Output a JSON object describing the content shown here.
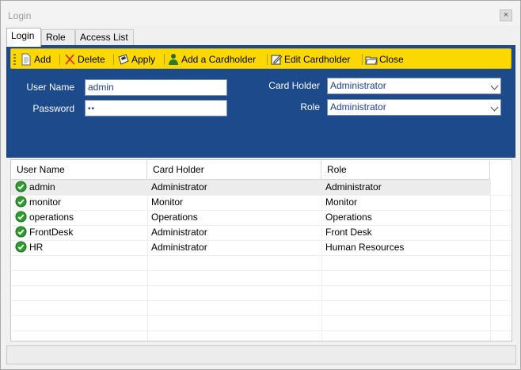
{
  "window": {
    "title": "Login",
    "close_label": "×"
  },
  "tabs": [
    {
      "label": "Login"
    },
    {
      "label": "Role"
    },
    {
      "label": "Access List"
    }
  ],
  "toolbar": {
    "add": "Add",
    "delete": "Delete",
    "apply": "Apply",
    "add_cardholder": "Add a Cardholder",
    "edit_cardholder": "Edit Cardholder",
    "close": "Close"
  },
  "form": {
    "user_name_label": "User Name",
    "user_name_value": "admin",
    "password_label": "Password",
    "password_value": "••",
    "card_holder_label": "Card Holder",
    "card_holder_value": "Administrator",
    "role_label": "Role",
    "role_value": "Administrator"
  },
  "grid": {
    "columns": [
      "User Name",
      "Card Holder",
      "Role"
    ],
    "rows": [
      {
        "user": "admin",
        "card_holder": "Administrator",
        "role": "Administrator"
      },
      {
        "user": "monitor",
        "card_holder": "Monitor",
        "role": "Monitor"
      },
      {
        "user": "operations",
        "card_holder": "Operations",
        "role": "Operations"
      },
      {
        "user": "FrontDesk",
        "card_holder": "Administrator",
        "role": "Front Desk"
      },
      {
        "user": "HR",
        "card_holder": "Administrator",
        "role": "Human Resources"
      }
    ]
  },
  "colors": {
    "panel_blue": "#1c4a8a",
    "toolbar_yellow": "#fbd802",
    "check_green": "#2e9b2e"
  }
}
